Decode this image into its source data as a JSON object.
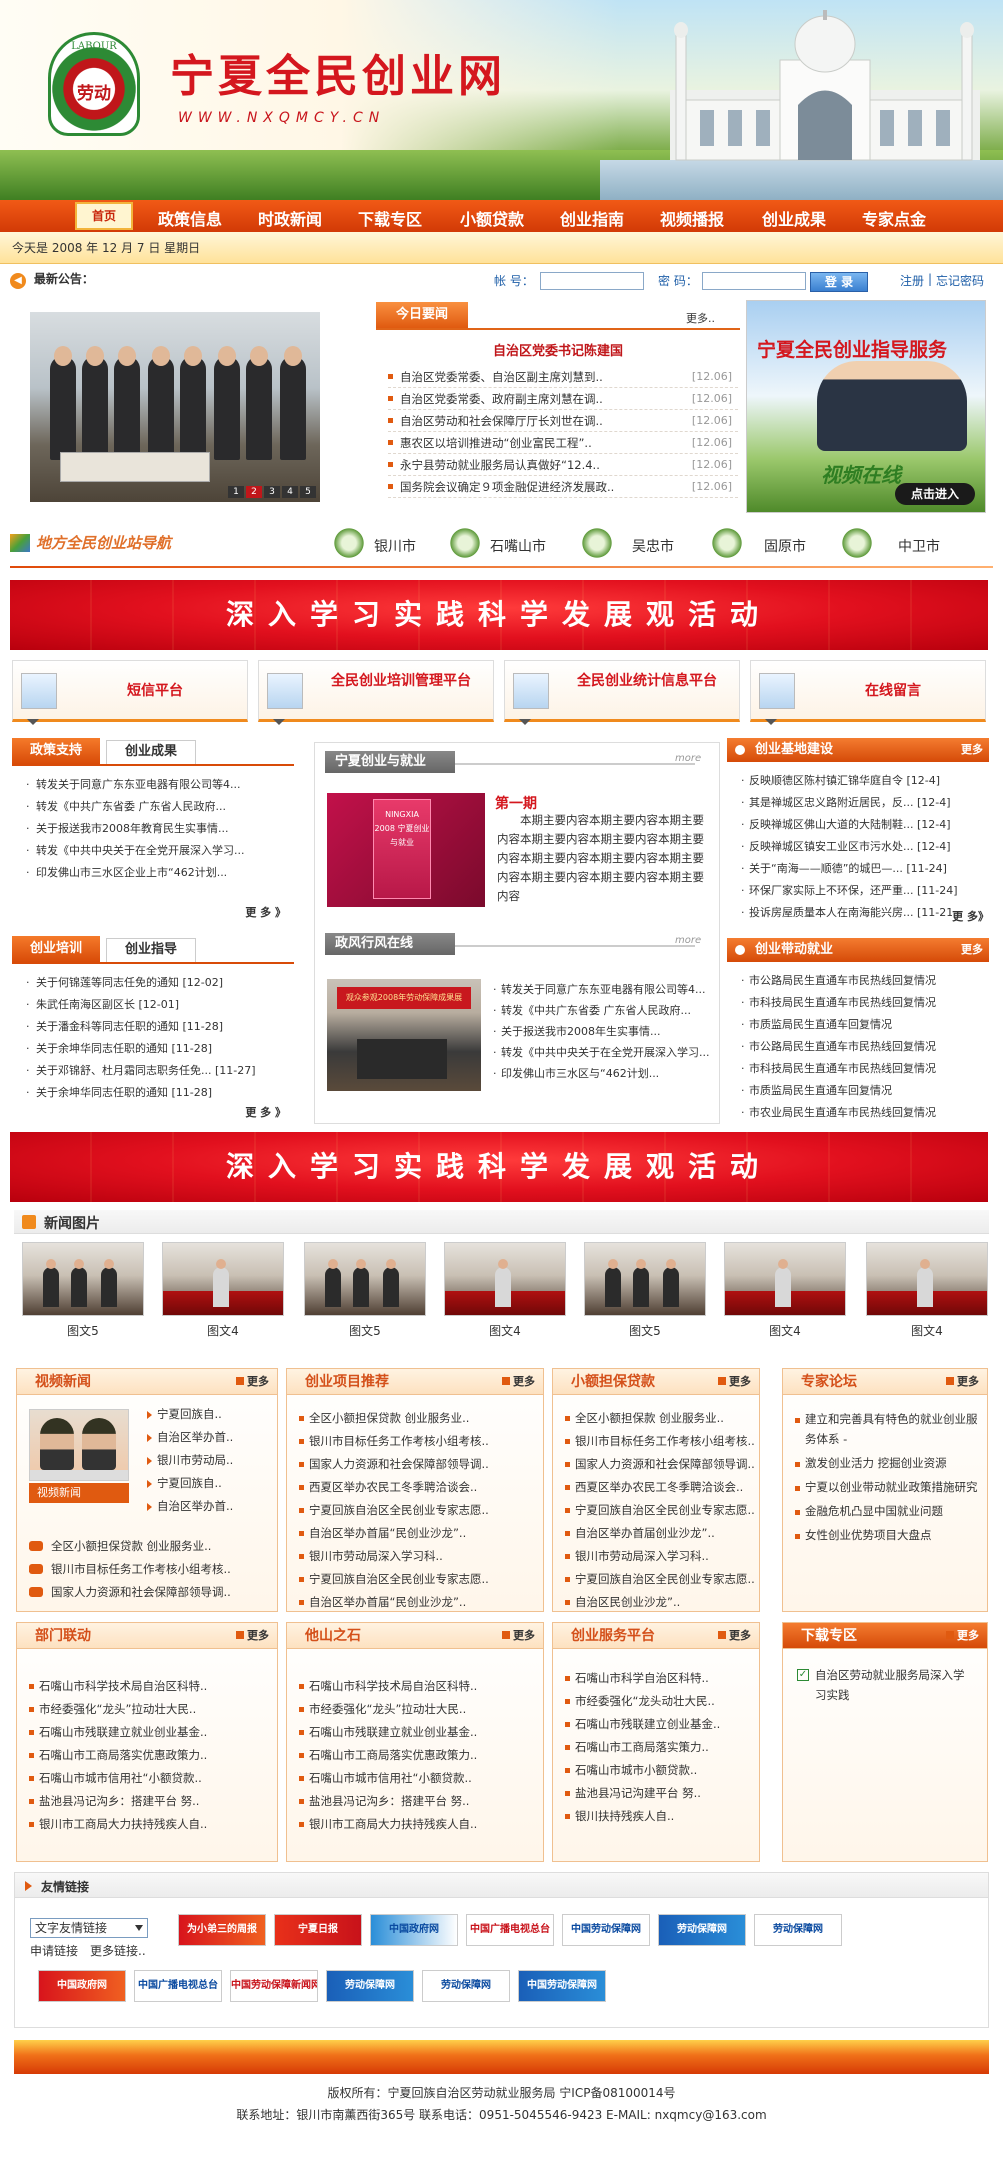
{
  "header": {
    "logo_arc": "LABOUR",
    "logo_text": "劳动",
    "site_name": "宁夏全民创业网",
    "site_url": "WWW.NXQMCY.CN"
  },
  "nav": {
    "home": "首页",
    "items": [
      "政策信息",
      "时政新闻",
      "下载专区",
      "小额贷款",
      "创业指南",
      "视频播报",
      "创业成果",
      "专家点金"
    ]
  },
  "datebar": {
    "text": "今天是 2008 年 12 月 7 日 星期日"
  },
  "notice": {
    "label": "最新公告：",
    "account_label": "帐 号：",
    "password_label": "密 码：",
    "login": "登 录",
    "register": "注册",
    "forgot": "忘记密码"
  },
  "slideshow": {
    "pages": [
      "1",
      "2",
      "3",
      "4",
      "5"
    ]
  },
  "todaynews": {
    "tab": "今日要闻",
    "more": "更多..",
    "headline": "自治区党委书记陈建国",
    "items": [
      {
        "t": "自治区党委常委、自治区副主席刘慧到..",
        "d": "[12.06]"
      },
      {
        "t": "自治区党委常委、政府副主席刘慧在调..",
        "d": "[12.06]"
      },
      {
        "t": "自治区劳动和社会保障厅厅长刘世在调..",
        "d": "[12.06]"
      },
      {
        "t": "惠农区以培训推进动“创业富民工程”..",
        "d": "[12.06]"
      },
      {
        "t": "永宁县劳动就业服务局认真做好“12.4..",
        "d": "[12.06]"
      },
      {
        "t": "国务院会议确定９项金融促进经济发展政..",
        "d": "[12.06]"
      }
    ]
  },
  "ad": {
    "title": "宁夏全民创业指导服务",
    "slogan": "视频在线",
    "button": "点击进入"
  },
  "citynav": {
    "title": "地方全民创业站导航",
    "cities": [
      "银川市",
      "石嘴山市",
      "吴忠市",
      "固原市",
      "中卫市"
    ]
  },
  "banner1": "深入学习实践科学发展观活动",
  "banner2": "深入学习实践科学发展观活动",
  "services": [
    {
      "label": "短信平台"
    },
    {
      "label": "全民创业培训管理平台"
    },
    {
      "label": "全民创业统计信息平台"
    },
    {
      "label": "在线留言"
    }
  ],
  "policy": {
    "tab1": "政策支持",
    "tab2": "创业成果",
    "items": [
      "转发关于同意广东东亚电器有限公司等4...",
      "转发《中共广东省委 广东省人民政府...",
      "关于报送我市2008年教育民生实事情...",
      "转发《中共中央关于在全党开展深入学习...",
      "印发佛山市三水区企业上市“462计划..."
    ],
    "more": "更 多 》"
  },
  "training": {
    "tab1": "创业培训",
    "tab2": "创业指导",
    "items": [
      "关于何锦莲等同志任免的通知 [12-02]",
      "朱武任南海区副区长 [12-01]",
      "关于潘金科等同志任职的通知 [11-28]",
      "关于余坤华同志任职的通知 [11-28]",
      "关于邓锦舒、杜月霜同志职务任免... [11-27]",
      "关于余坤华同志任职的通知 [11-28]"
    ],
    "more": "更 多 》"
  },
  "center": {
    "title1": "宁夏创业与就业",
    "more1": "more",
    "issue": "第一期",
    "book_text": "NINGXIA 2008 宁夏创业与就业",
    "para": "本期主要内容本期主要内容本期主要内容本期主要内容本期主要内容本期主要内容本期主要内容本期主要内容本期主要内容本期主要内容本期主要内容本期主要内容",
    "title2": "政风行风在线",
    "more2": "more",
    "photo_banner": "观众参观2008年劳动保障成果展",
    "items": [
      "转发关于同意广东东亚电器有限公司等4...",
      "转发《中共广东省委 广东省人民政府...",
      "关于报送我市2008年生实事情...",
      "转发《中共中央关于在全党开展深入学习...",
      "印发佛山市三水区与“462计划..."
    ]
  },
  "base": {
    "title": "创业基地建设",
    "more": "更多",
    "items": [
      "反映顺德区陈村镇汇锦华庭自令 [12-4]",
      "其是禅城区忠义路附近居民，反... [12-4]",
      "反映禅城区佛山大道的大陆制鞋... [12-4]",
      "反映禅城区镇安工业区市污水处... [12-4]",
      "关于“南海——顺德”的城巴—... [11-24]",
      "环保厂家实际上不环保，还严重... [11-24]",
      "投诉房屋质量本人在南海能兴房... [11-21]"
    ],
    "more_link": "更 多》"
  },
  "drive": {
    "title": "创业带动就业",
    "more": "更多",
    "items": [
      "市公路局民生直通车市民热线回复情况",
      "市科技局民生直通车市民热线回复情况",
      "市质监局民生直通车回复情况",
      "市公路局民生直通车市民热线回复情况",
      "市科技局民生直通车市民热线回复情况",
      "市质监局民生直通车回复情况",
      "市农业局民生直通车市民热线回复情况"
    ]
  },
  "newspics": {
    "title": "新闻图片",
    "captions": [
      "图文5",
      "图文4",
      "图文5",
      "图文4",
      "图文5",
      "图文4",
      "图文4"
    ]
  },
  "video": {
    "title": "视频新闻",
    "more": "更多",
    "label": "视频新闻",
    "side": [
      "宁夏回族自..",
      "自治区举办首..",
      "银川市劳动局..",
      "宁夏回族自..",
      "自治区举办首.."
    ],
    "items": [
      "全区小额担保贷款 创业服务业..",
      "银川市目标任务工作考核小组考核..",
      "国家人力资源和社会保障部领导调.."
    ]
  },
  "projects": {
    "title": "创业项目推荐",
    "more": "更多",
    "items": [
      "全区小额担保贷款 创业服务业..",
      "银川市目标任务工作考核小组考核..",
      "国家人力资源和社会保障部领导调..",
      "西夏区举办农民工冬季聘洽谈会..",
      "宁夏回族自治区全民创业专家志愿..",
      "自治区举办首届“民创业沙龙”..",
      "银川市劳动局深入学习科..",
      "宁夏回族自治区全民创业专家志愿..",
      "自治区举办首届“民创业沙龙”.."
    ]
  },
  "loans": {
    "title": "小额担保贷款",
    "more": "更多",
    "items": [
      "全区小额担保款 创业服务业..",
      "银川市目标任务工作考核小组考核..",
      "国家人力资源和社会保障部领导调..",
      "西夏区举办农民工冬季聘洽谈会..",
      "宁夏回族自治区全民创业专家志愿..",
      "自治区举办首届创业沙龙”..",
      "银川市劳动局深入学习科..",
      "宁夏回族自治区全民创业专家志愿..",
      "自治区民创业沙龙”.."
    ]
  },
  "experts": {
    "title": "专家论坛",
    "more": "更多",
    "items": [
      "建立和完善具有特色的就业创业服务体系 -",
      "激发创业活力 挖掘创业资源",
      "宁夏以创业带动就业政策措施研究",
      "金融危机凸显中国就业问题",
      "女性创业优势项目大盘点"
    ]
  },
  "linkage": {
    "title": "部门联动",
    "more": "更多",
    "items": [
      "石嘴山市科学技术局自治区科特..",
      "市经委强化“龙头”拉动壮大民..",
      "石嘴山市残联建立就业创业基金..",
      "石嘴山市工商局落实优惠政策力..",
      "石嘴山市城市信用社“小额贷款..",
      "盐池县冯记沟乡：搭建平台 努..",
      "银川市工商局大力扶持残疾人自.."
    ]
  },
  "stones": {
    "title": "他山之石",
    "more": "更多",
    "items": [
      "石嘴山市科学技术局自治区科特..",
      "市经委强化“龙头”拉动壮大民..",
      "石嘴山市残联建立就业创业基金..",
      "石嘴山市工商局落实优惠政策力..",
      "石嘴山市城市信用社“小额贷款..",
      "盐池县冯记沟乡：搭建平台 努..",
      "银川市工商局大力扶持残疾人自.."
    ]
  },
  "platform": {
    "title": "创业服务平台",
    "more": "更多",
    "items": [
      "石嘴山市科学自治区科特..",
      "市经委强化“龙头动壮大民..",
      "石嘴山市残联建立创业基金..",
      "石嘴山市工商局落实策力..",
      "石嘴山市城市小额贷款..",
      "盐池县冯记沟建平台 努..",
      "银川扶持残疾人自.."
    ]
  },
  "download": {
    "title": "下载专区",
    "more": "更多",
    "item": "自治区劳动就业服务局深入学习实践"
  },
  "links": {
    "title": "友情链接",
    "select": "文字友情链接",
    "apply": "申请链接",
    "more": "更多链接..",
    "row1": [
      "为小弟三的周报",
      "宁夏日报",
      "中国政府网",
      "中国广播电视总台",
      "中国劳动保障网",
      "劳动保障网",
      "劳动保障网"
    ],
    "row2": [
      "中国政府网",
      "中国广播电视总台",
      "中国劳动保障新闻网",
      "劳动保障网",
      "劳动保障网",
      "中国劳动保障网"
    ]
  },
  "footer": {
    "line1": "版权所有：宁夏回族自治区劳动就业服务局 宁ICP备08100014号",
    "line2": "联系地址：银川市南薰西街365号 联系电话：0951-5045546-9423 E-MAIL: nxqmcy@163.com"
  },
  "colors": {
    "accent": "#e05a10",
    "brand_red": "#d4171e",
    "link_green": "#2d8a35"
  }
}
